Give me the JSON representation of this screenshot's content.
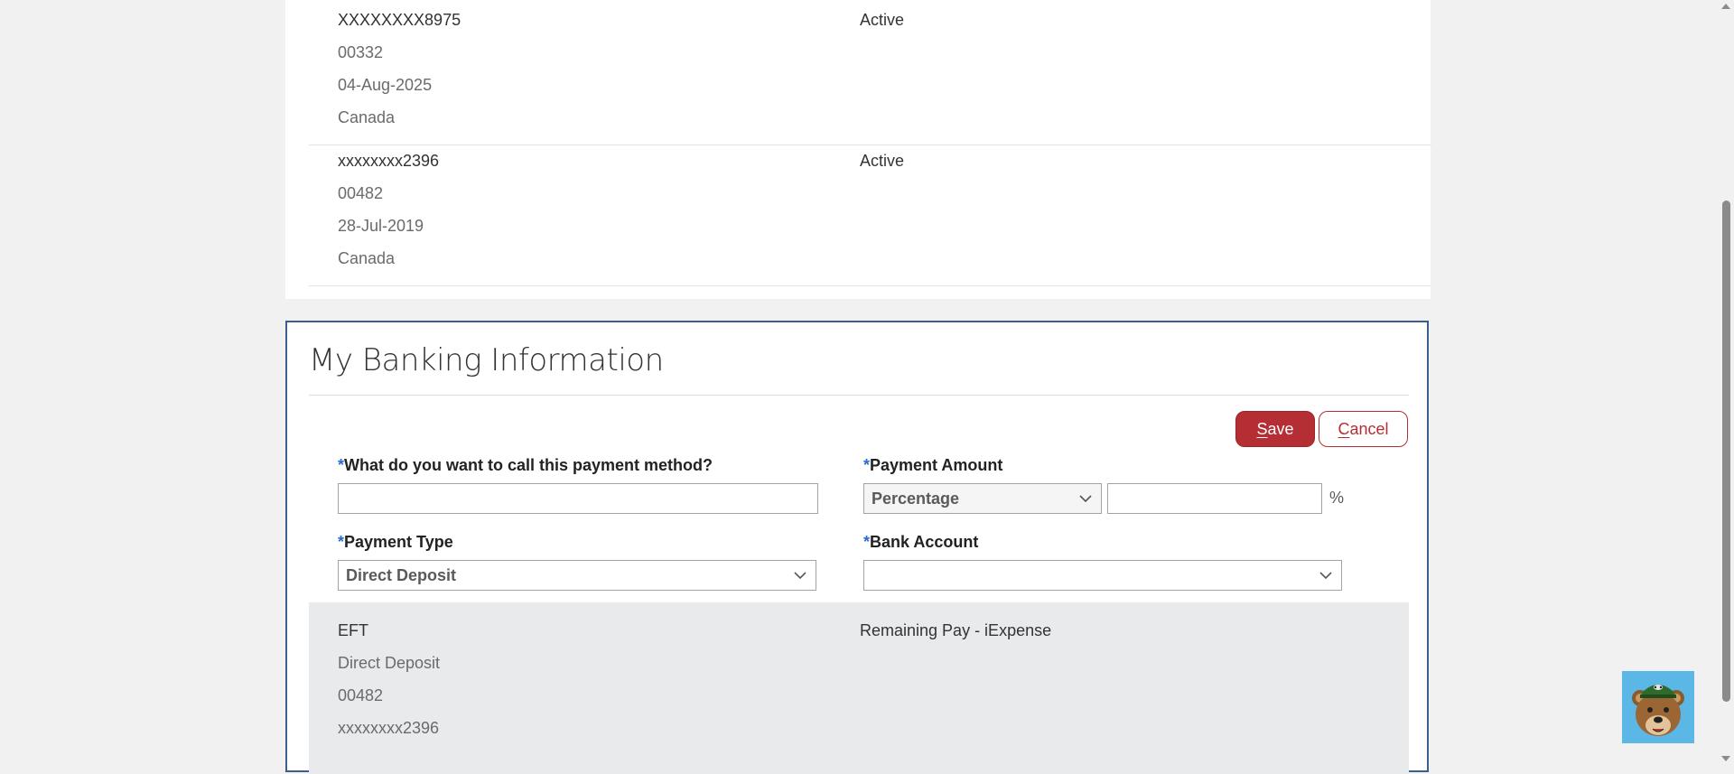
{
  "accounts": [
    {
      "lines": [
        "XXXXXXXX8975",
        "00332",
        "04-Aug-2025",
        "Canada"
      ],
      "status": "Active"
    },
    {
      "lines": [
        "xxxxxxxx2396",
        "00482",
        "28-Jul-2019",
        "Canada"
      ],
      "status": "Active"
    }
  ],
  "form": {
    "title": "My Banking Information",
    "save_label": "Save",
    "save_key": "S",
    "save_rest": "ave",
    "cancel_label": "Cancel",
    "cancel_key": "C",
    "cancel_rest": "ancel",
    "required_mark": "*",
    "name_label": "What do you want to call this payment method?",
    "name_value": "",
    "amount_label": "Payment Amount",
    "amount_type": "Percentage",
    "amount_value": "",
    "amount_unit": "%",
    "payment_type_label": "Payment Type",
    "payment_type": "Direct Deposit",
    "bank_account_label": "Bank Account",
    "bank_account": ""
  },
  "summary": {
    "lines": [
      "EFT",
      "Direct Deposit",
      "00482",
      "xxxxxxxx2396"
    ],
    "right": "Remaining Pay - iExpense"
  },
  "colors": {
    "accent": "#b42e34",
    "panel_border": "#3a5f8f",
    "required": "#2a6bd1"
  },
  "icons": {
    "dropdown": "chevron-down-icon",
    "mascot": "bear-mascot-icon"
  }
}
